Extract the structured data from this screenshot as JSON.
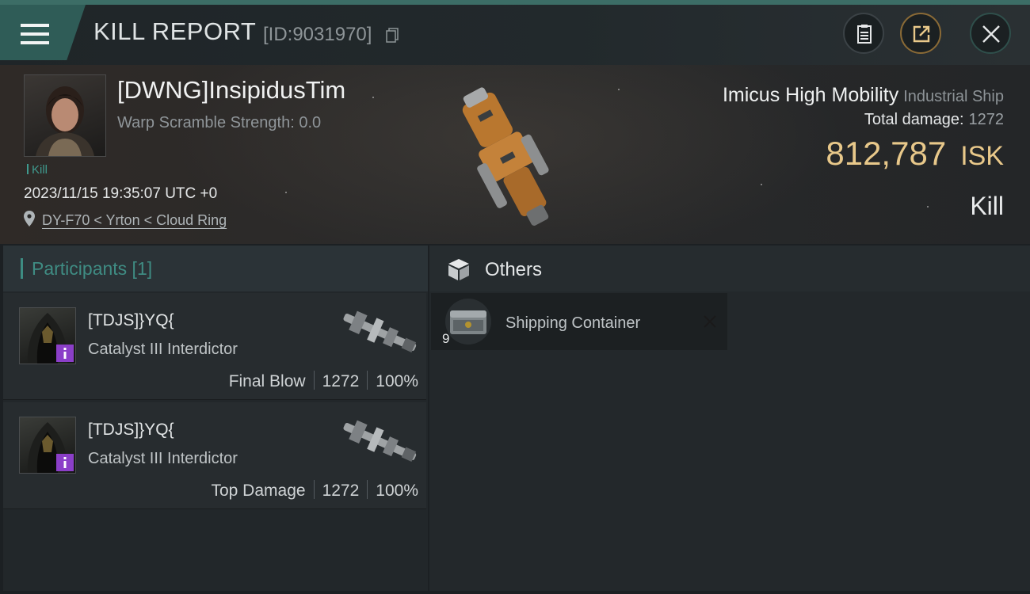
{
  "header": {
    "title": "KILL REPORT",
    "report_id": "[ID:9031970]",
    "icons": [
      "menu-icon",
      "copy-icon",
      "clipboard-icon",
      "share-icon",
      "close-icon"
    ],
    "accent_color": "#2f5c57"
  },
  "victim": {
    "name": "[DWNG]InsipidusTim",
    "warp_scramble": "Warp Scramble Strength: 0.0",
    "tag": "Kill",
    "datetime": "2023/11/15 19:35:07 UTC +0",
    "location": "DY-F70 < Yrton < Cloud Ring",
    "ship_name": "Imicus High Mobility",
    "ship_class": "Industrial Ship",
    "total_damage_label": "Total damage:",
    "total_damage_value": "1272",
    "isk_value": "812,787",
    "isk_unit": "ISK",
    "result": "Kill",
    "isk_color": "#e8c88a"
  },
  "participants": {
    "title": "Participants [1]",
    "rows": [
      {
        "name": "[TDJS]}YQ{",
        "ship": "Catalyst III Interdictor",
        "role": "Final Blow",
        "damage": "1272",
        "percent": "100%"
      },
      {
        "name": "[TDJS]}YQ{",
        "ship": "Catalyst III Interdictor",
        "role": "Top Damage",
        "damage": "1272",
        "percent": "100%"
      }
    ],
    "accent_color": "#3d8c82"
  },
  "others": {
    "title": "Others",
    "items": [
      {
        "quantity": "9",
        "name": "Shipping Container"
      }
    ]
  }
}
